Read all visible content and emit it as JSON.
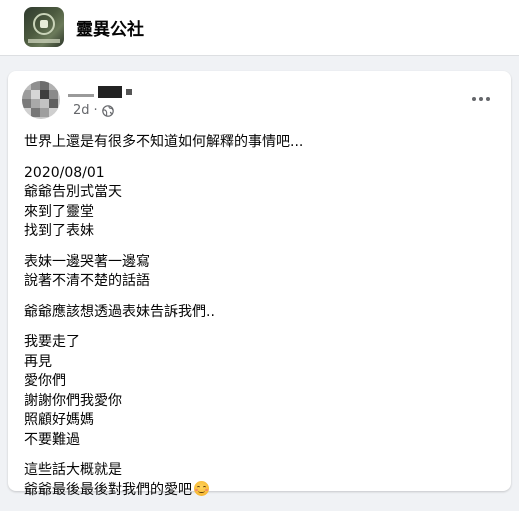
{
  "group": {
    "name": "靈異公社",
    "avatar_icon": "group-emblem-icon"
  },
  "post": {
    "author_icon": "blurred-avatar",
    "time": "2d",
    "separator": "·",
    "privacy_icon": "globe-icon",
    "more_icon": "more-options-icon",
    "paragraphs": [
      [
        "世界上還是有很多不知道如何解釋的事情吧..."
      ],
      [
        "2020/08/01",
        "爺爺告別式當天",
        "來到了靈堂",
        "找到了表妹"
      ],
      [
        "表妹一邊哭著一邊寫",
        "說著不清不楚的話語"
      ],
      [
        "爺爺應該想透過表妹告訴我們.."
      ],
      [
        "我要走了",
        "再見",
        "愛你們",
        "謝謝你們我愛你",
        "照顧好媽媽",
        "不要難過"
      ],
      [
        "這些話大概就是",
        "爺爺最後最後對我們的愛吧"
      ]
    ],
    "trailing_emoji": "smiling-face-with-smiling-eyes-emoji"
  },
  "colors": {
    "page_bg": "#f0f2f5",
    "card_bg": "#ffffff",
    "meta_text": "#65676b",
    "body_text": "#050505"
  }
}
